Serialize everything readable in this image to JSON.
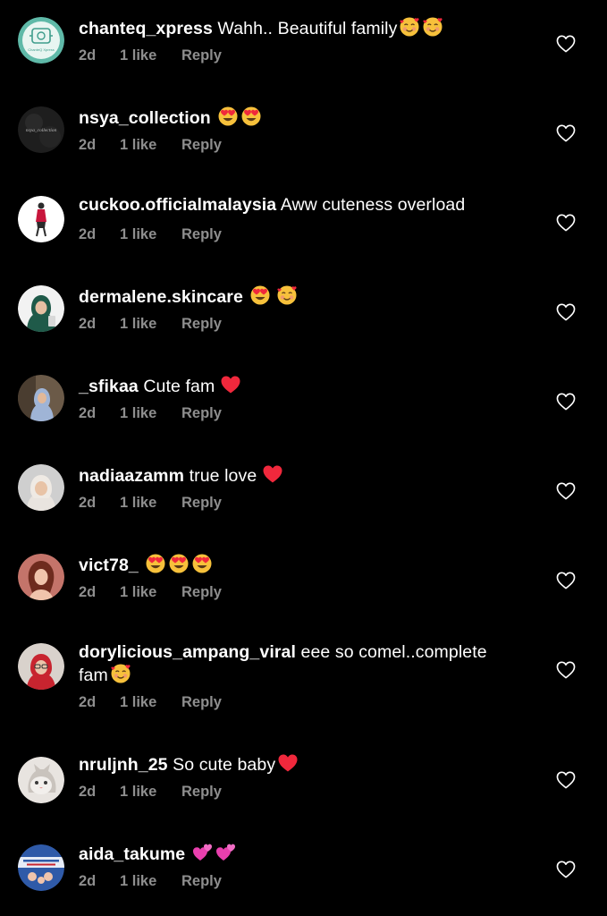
{
  "comments": [
    {
      "username": "chanteq_xpress",
      "text": "Wahh.. Beautiful family",
      "emojis": [
        "smiling-face-with-hearts",
        "smiling-face-with-hearts"
      ],
      "age": "2d",
      "likes": "1 like",
      "reply": "Reply",
      "avatar_text": "ChanteQ Xpress"
    },
    {
      "username": "nsya_collection",
      "text": "",
      "emojis": [
        "heart-eyes",
        "heart-eyes"
      ],
      "age": "2d",
      "likes": "1 like",
      "reply": "Reply",
      "avatar_text": "nsya_collection"
    },
    {
      "username": "cuckoo.officialmalaysia",
      "text": "Aww cuteness overload",
      "emojis": [],
      "age": "2d",
      "likes": "1 like",
      "reply": "Reply"
    },
    {
      "username": "dermalene.skincare",
      "text": "",
      "emojis": [
        "heart-eyes",
        "smiling-face-with-hearts"
      ],
      "age": "2d",
      "likes": "1 like",
      "reply": "Reply"
    },
    {
      "username": "_sfikaa",
      "text": "Cute fam",
      "emojis": [
        "red-heart"
      ],
      "age": "2d",
      "likes": "1 like",
      "reply": "Reply"
    },
    {
      "username": "nadiaazamm",
      "text": "true love",
      "emojis": [
        "red-heart"
      ],
      "age": "2d",
      "likes": "1 like",
      "reply": "Reply"
    },
    {
      "username": "vict78_",
      "text": "",
      "emojis": [
        "heart-eyes",
        "heart-eyes",
        "heart-eyes"
      ],
      "age": "2d",
      "likes": "1 like",
      "reply": "Reply"
    },
    {
      "username": "dorylicious_ampang_viral",
      "text": "eee so comel..complete fam",
      "emojis": [
        "smiling-face-with-hearts"
      ],
      "age": "2d",
      "likes": "1 like",
      "reply": "Reply"
    },
    {
      "username": "nruljnh_25",
      "text": "So cute baby",
      "emojis": [
        "red-heart"
      ],
      "age": "2d",
      "likes": "1 like",
      "reply": "Reply"
    },
    {
      "username": "aida_takume",
      "text": "",
      "emojis": [
        "revolving-hearts",
        "revolving-hearts"
      ],
      "age": "2d",
      "likes": "1 like",
      "reply": "Reply"
    }
  ],
  "icons": {
    "like": "heart-outline-icon"
  },
  "colors": {
    "background": "#000000",
    "text": "#ffffff",
    "secondary": "#8e8e8e",
    "emoji_face": "#f7c13b",
    "heart": "#f0283c"
  }
}
